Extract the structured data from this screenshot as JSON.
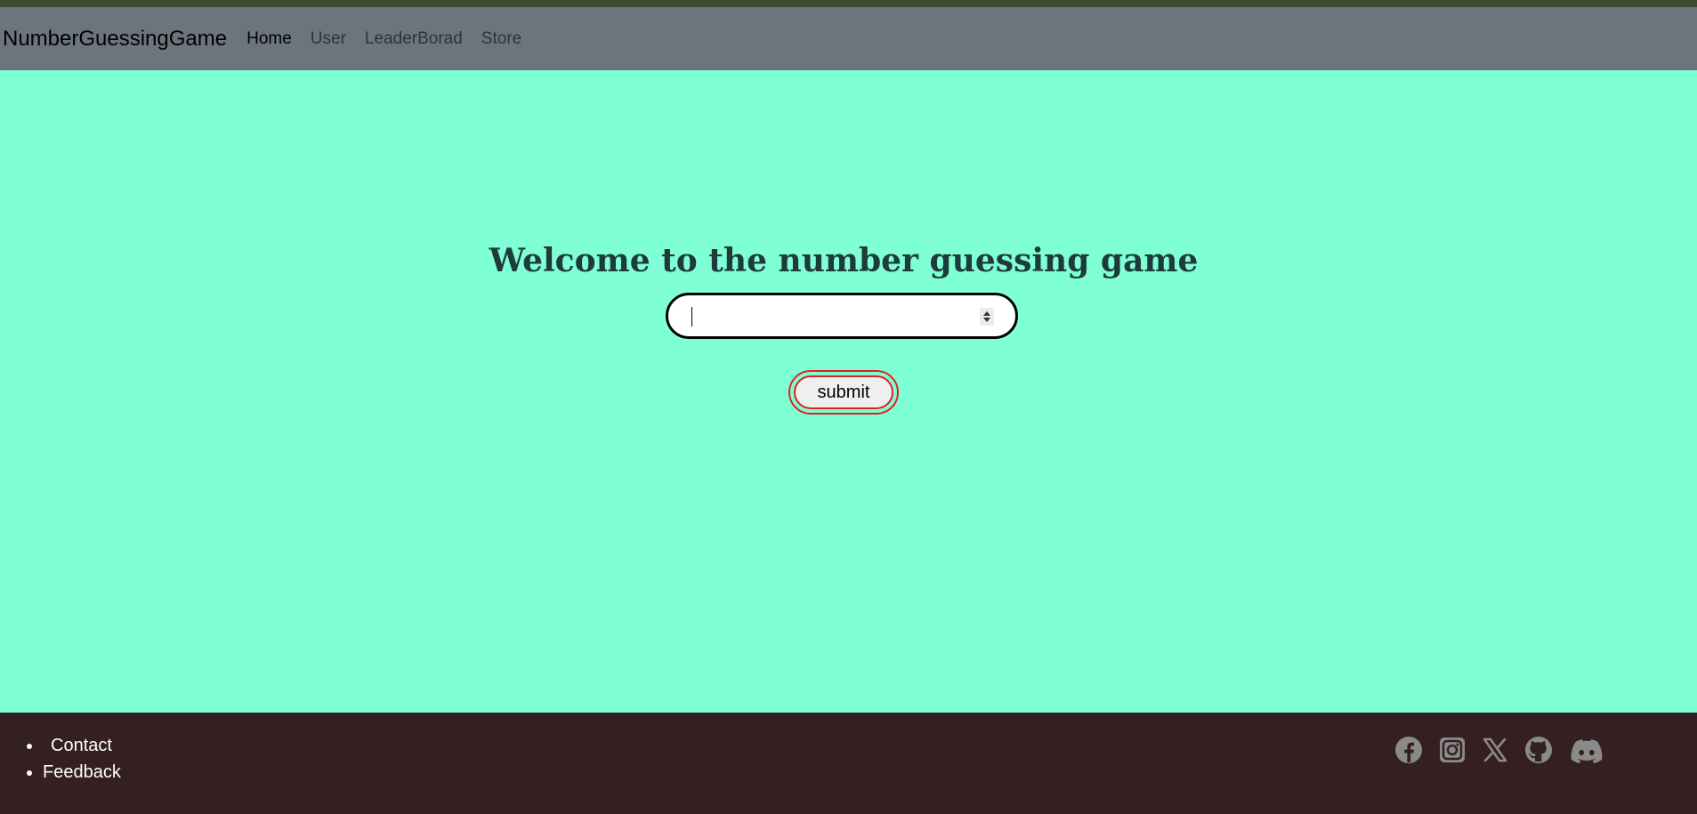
{
  "navbar": {
    "brand": "NumberGuessingGame",
    "links": [
      {
        "label": "Home"
      },
      {
        "label": "User"
      },
      {
        "label": "LeaderBorad"
      },
      {
        "label": "Store"
      }
    ]
  },
  "main": {
    "title": "Welcome to the number guessing game",
    "guess_input": {
      "value": "",
      "placeholder": ""
    },
    "submit_label": "submit"
  },
  "footer": {
    "links": [
      {
        "label": "Contact"
      },
      {
        "label": "Feedback"
      }
    ],
    "social": [
      "facebook-icon",
      "instagram-icon",
      "x-icon",
      "github-icon",
      "discord-icon"
    ]
  },
  "colors": {
    "background": "#7fffd4",
    "navbar": "#6c757d",
    "footer": "#341f21",
    "submit_border": "#e02020",
    "icon": "#8a8a8a"
  }
}
